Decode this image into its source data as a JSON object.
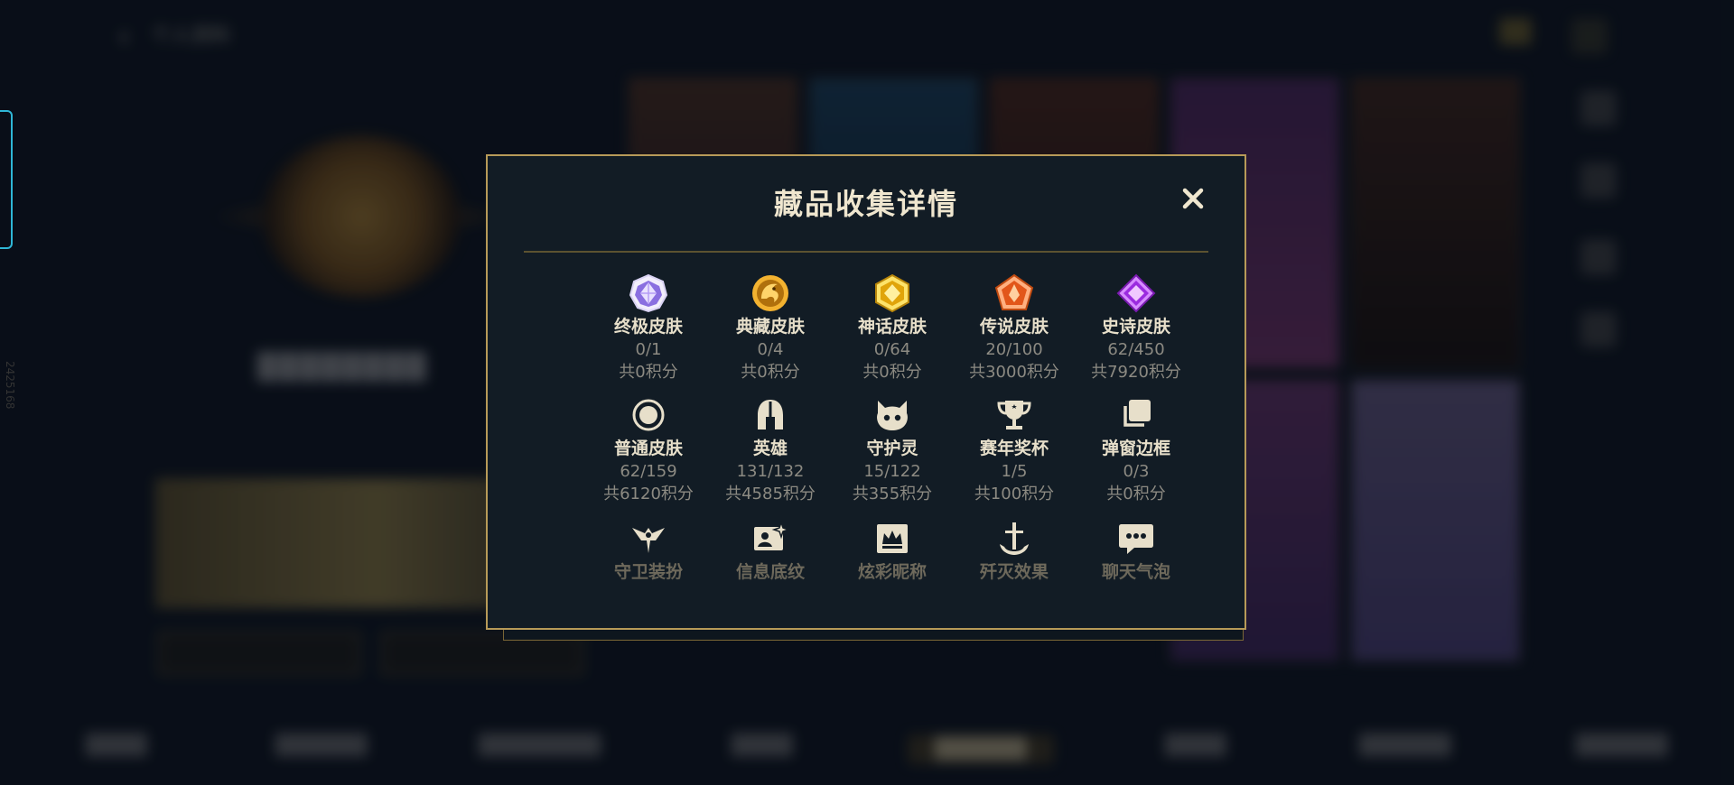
{
  "background": {
    "back_label": "个人资料",
    "player_name": "████████",
    "side_vertical_text": "2425168",
    "tabs": [
      "████",
      "██████",
      "████████",
      "████",
      "██████",
      "████",
      "██████",
      "██████"
    ]
  },
  "modal": {
    "title": "藏品收集详情",
    "rows": [
      [
        {
          "label": "终极皮肤",
          "count": "0/1",
          "points": "共0积分",
          "icon": "ultimate-skin-icon",
          "color": "#c7b2ff"
        },
        {
          "label": "典藏皮肤",
          "count": "0/4",
          "points": "共0积分",
          "icon": "collector-skin-icon",
          "color": "#f0a019"
        },
        {
          "label": "神话皮肤",
          "count": "0/64",
          "points": "共0积分",
          "icon": "mythic-skin-icon",
          "color": "#f4c51a"
        },
        {
          "label": "传说皮肤",
          "count": "20/100",
          "points": "共3000积分",
          "icon": "legendary-skin-icon",
          "color": "#ef6a22"
        },
        {
          "label": "史诗皮肤",
          "count": "62/450",
          "points": "共7920积分",
          "icon": "epic-skin-icon",
          "color": "#b93dff"
        }
      ],
      [
        {
          "label": "普通皮肤",
          "count": "62/159",
          "points": "共6120积分",
          "icon": "normal-skin-icon"
        },
        {
          "label": "英雄",
          "count": "131/132",
          "points": "共4585积分",
          "icon": "hero-helmet-icon"
        },
        {
          "label": "守护灵",
          "count": "15/122",
          "points": "共355积分",
          "icon": "guardian-spirit-icon"
        },
        {
          "label": "赛年奖杯",
          "count": "1/5",
          "points": "共100积分",
          "icon": "trophy-icon"
        },
        {
          "label": "弹窗边框",
          "count": "0/3",
          "points": "共0积分",
          "icon": "popup-frame-icon"
        }
      ],
      [
        {
          "label": "守卫装扮",
          "icon": "ward-skin-icon"
        },
        {
          "label": "信息底纹",
          "icon": "info-card-icon"
        },
        {
          "label": "炫彩昵称",
          "icon": "nickname-icon"
        },
        {
          "label": "歼灭效果",
          "icon": "ace-effect-icon"
        },
        {
          "label": "聊天气泡",
          "icon": "chat-bubble-icon"
        }
      ]
    ]
  }
}
